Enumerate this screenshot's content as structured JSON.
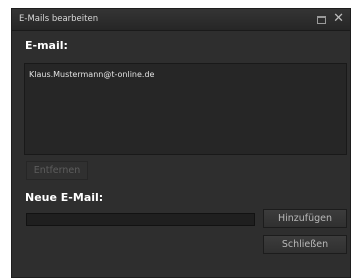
{
  "window": {
    "title": "E-Mails bearbeiten"
  },
  "email_section": {
    "heading": "E-mail:",
    "items": [
      "Klaus.Mustermann@t-online.de"
    ]
  },
  "buttons": {
    "remove": "Entfernen",
    "add": "Hinzufügen",
    "close": "Schließen"
  },
  "new_email": {
    "heading": "Neue E-Mail:",
    "value": ""
  },
  "icons": {
    "maximize": "maximize-icon",
    "close": "close-icon"
  },
  "colors": {
    "window_bg": "#2e2e2e",
    "list_bg": "#262626",
    "text": "#ffffff"
  }
}
